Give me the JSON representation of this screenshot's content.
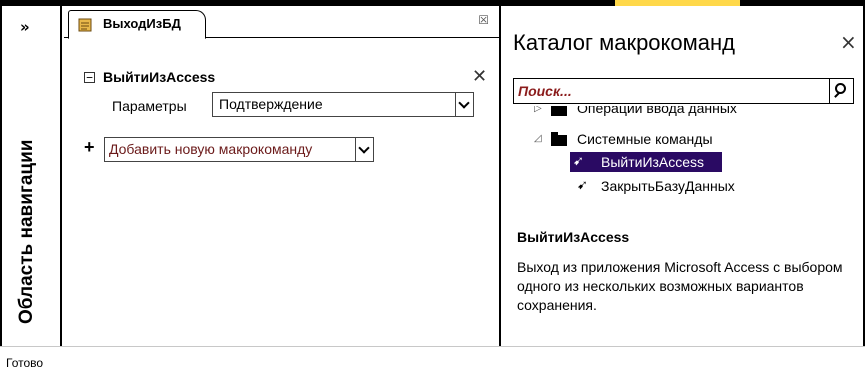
{
  "nav_pane": {
    "toggle": "»",
    "title": "Область навигации"
  },
  "document": {
    "tab_label": "ВыходИзБД",
    "tab_close": "☒"
  },
  "macro": {
    "collapse_symbol": "⊟",
    "action_name": "ВыйтиИзAccess",
    "delete_symbol": "✕",
    "param_label": "Параметры",
    "param_value": "Подтверждение",
    "add_plus": "+",
    "add_new_macro": "Добавить новую макрокоманду"
  },
  "catalog": {
    "title": "Каталог макрокоманд",
    "close": "×",
    "search_placeholder": "Поиск...",
    "tree": [
      {
        "label": "Операции ввода данных",
        "type": "folder",
        "expanded": false
      },
      {
        "label": "Системные команды",
        "type": "folder",
        "expanded": true
      },
      {
        "label": "ВыйтиИзAccess",
        "type": "action",
        "selected": true
      },
      {
        "label": "ЗакрытьБазуДанных",
        "type": "action",
        "selected": false
      }
    ],
    "description_title": "ВыйтиИзAccess",
    "description_text": "Выход из приложения Microsoft Access с выбором одного из нескольких возможных вариантов сохранения."
  },
  "status_bar": {
    "text": "Готово"
  },
  "colors": {
    "selection_bg": "#2a0a63",
    "accent_dark_red": "#8b1c1c",
    "add_macro_text": "#6b1a1a"
  }
}
